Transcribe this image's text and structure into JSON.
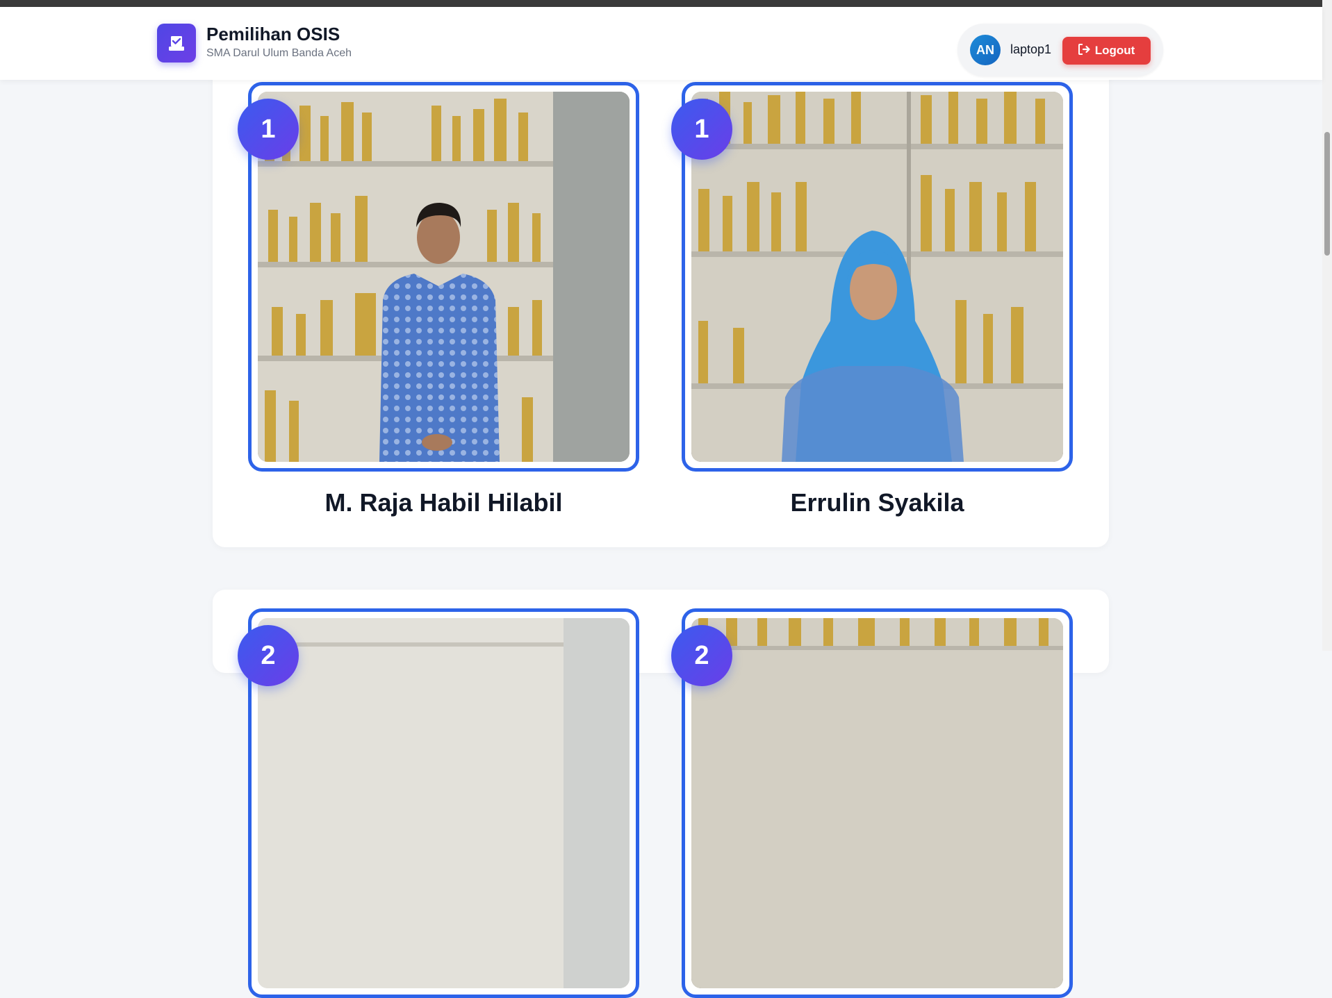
{
  "header": {
    "title": "Pemilihan OSIS",
    "subtitle": "SMA Darul Ulum Banda Aceh",
    "user_initials": "AN",
    "username": "laptop1",
    "logout_label": "Logout"
  },
  "candidates": [
    {
      "number": "1",
      "name": "M. Raja Habil Hilabil"
    },
    {
      "number": "1",
      "name": "Errulin Syakila"
    },
    {
      "number": "2",
      "name": ""
    },
    {
      "number": "2",
      "name": ""
    }
  ],
  "colors": {
    "accent": "#2d63e9",
    "badge": "#4f46e5",
    "logout": "#e53e3e"
  }
}
